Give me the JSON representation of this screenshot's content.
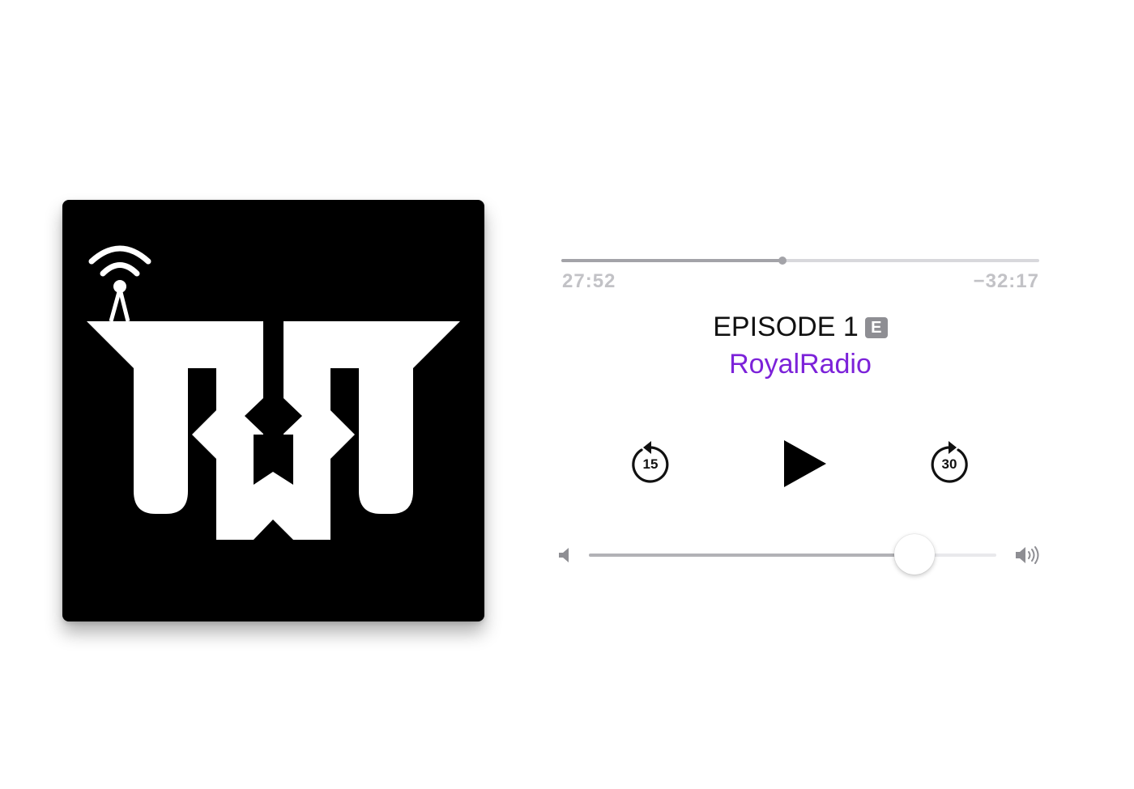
{
  "artwork": {
    "logo_name": "RoyalRadio RR logo",
    "background": "#000000",
    "foreground": "#ffffff"
  },
  "player": {
    "elapsed": "27:52",
    "remaining": "−32:17",
    "progress": 0.463,
    "episode_title": "EPISODE 1",
    "explicit_badge": "E",
    "artist": "RoyalRadio",
    "skip_back_seconds": "15",
    "skip_forward_seconds": "30",
    "volume": 0.8,
    "colors": {
      "accent": "#7c22d9",
      "track": "#d8d8dc",
      "track_fill": "#a3a3a8",
      "time_text": "#c2c2c6"
    },
    "icons": {
      "skip_back": "gobackward-15-icon",
      "play": "play-icon",
      "skip_forward": "goforward-30-icon",
      "volume_low": "speaker-low-icon",
      "volume_high": "speaker-high-icon"
    }
  }
}
